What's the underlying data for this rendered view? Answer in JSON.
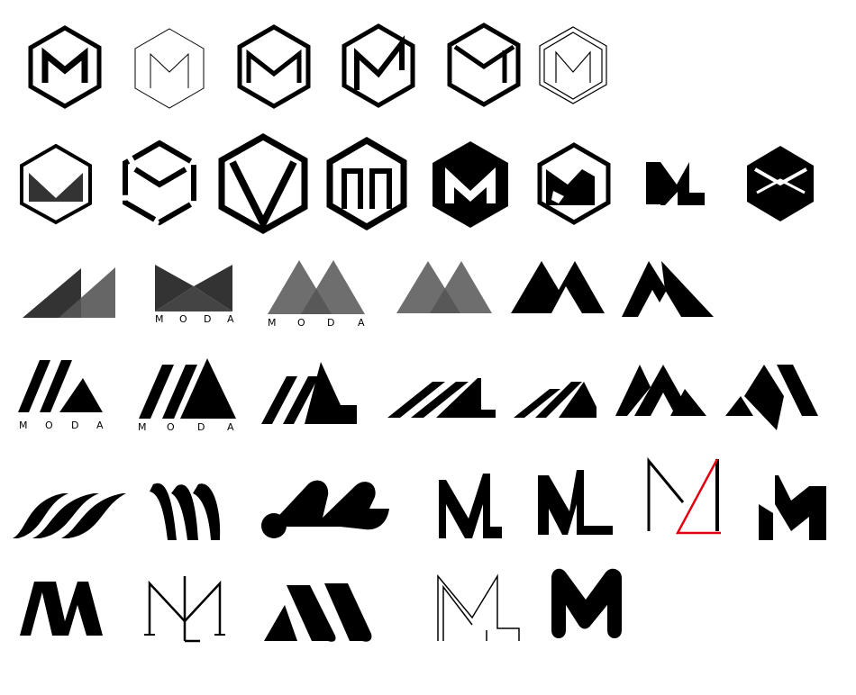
{
  "sheet": {
    "background": "#ffffff",
    "ink": "#000000",
    "accent": "#e3000f",
    "translucent_grey": "#555555"
  },
  "wordmark": {
    "letters": [
      "M",
      "O",
      "D",
      "A"
    ]
  },
  "logos": [
    {
      "name": "hex-m-outline-thick"
    },
    {
      "name": "hex-m-outline-thin"
    },
    {
      "name": "hex-m-open-bottom"
    },
    {
      "name": "hex-m-interlocked"
    },
    {
      "name": "hex-m-box"
    },
    {
      "name": "hex-m-double-line"
    },
    {
      "name": "hex-m-cut-fill"
    },
    {
      "name": "hex-m-cube"
    },
    {
      "name": "hex-v-shield"
    },
    {
      "name": "hex-m-pillars"
    },
    {
      "name": "hex-m-solid"
    },
    {
      "name": "hex-m-notched"
    },
    {
      "name": "ml-monogram-bold"
    },
    {
      "name": "cube-m-solid"
    },
    {
      "name": "mountains-right-triangles"
    },
    {
      "name": "bowtie-moda"
    },
    {
      "name": "overlap-triangles-moda"
    },
    {
      "name": "overlap-triangles"
    },
    {
      "name": "m-solid-peaks"
    },
    {
      "name": "m-split-peak"
    },
    {
      "name": "slash-triangle-moda-a"
    },
    {
      "name": "slash-triangle-moda-b"
    },
    {
      "name": "slash-l-triangle"
    },
    {
      "name": "slash-wedge-long"
    },
    {
      "name": "slash-wedge-short"
    },
    {
      "name": "triple-peaks"
    },
    {
      "name": "slanted-peaks"
    },
    {
      "name": "swoosh-stripes"
    },
    {
      "name": "calligraphic-m"
    },
    {
      "name": "ribbon-m"
    },
    {
      "name": "ml-sharp-a"
    },
    {
      "name": "ml-sharp-b"
    },
    {
      "name": "ml-red-accent"
    },
    {
      "name": "m-block-geometric"
    },
    {
      "name": "nm-slanted"
    },
    {
      "name": "ml-serif-line"
    },
    {
      "name": "brush-m"
    },
    {
      "name": "ml-thin-outline"
    },
    {
      "name": "m-rounded-bold"
    }
  ]
}
